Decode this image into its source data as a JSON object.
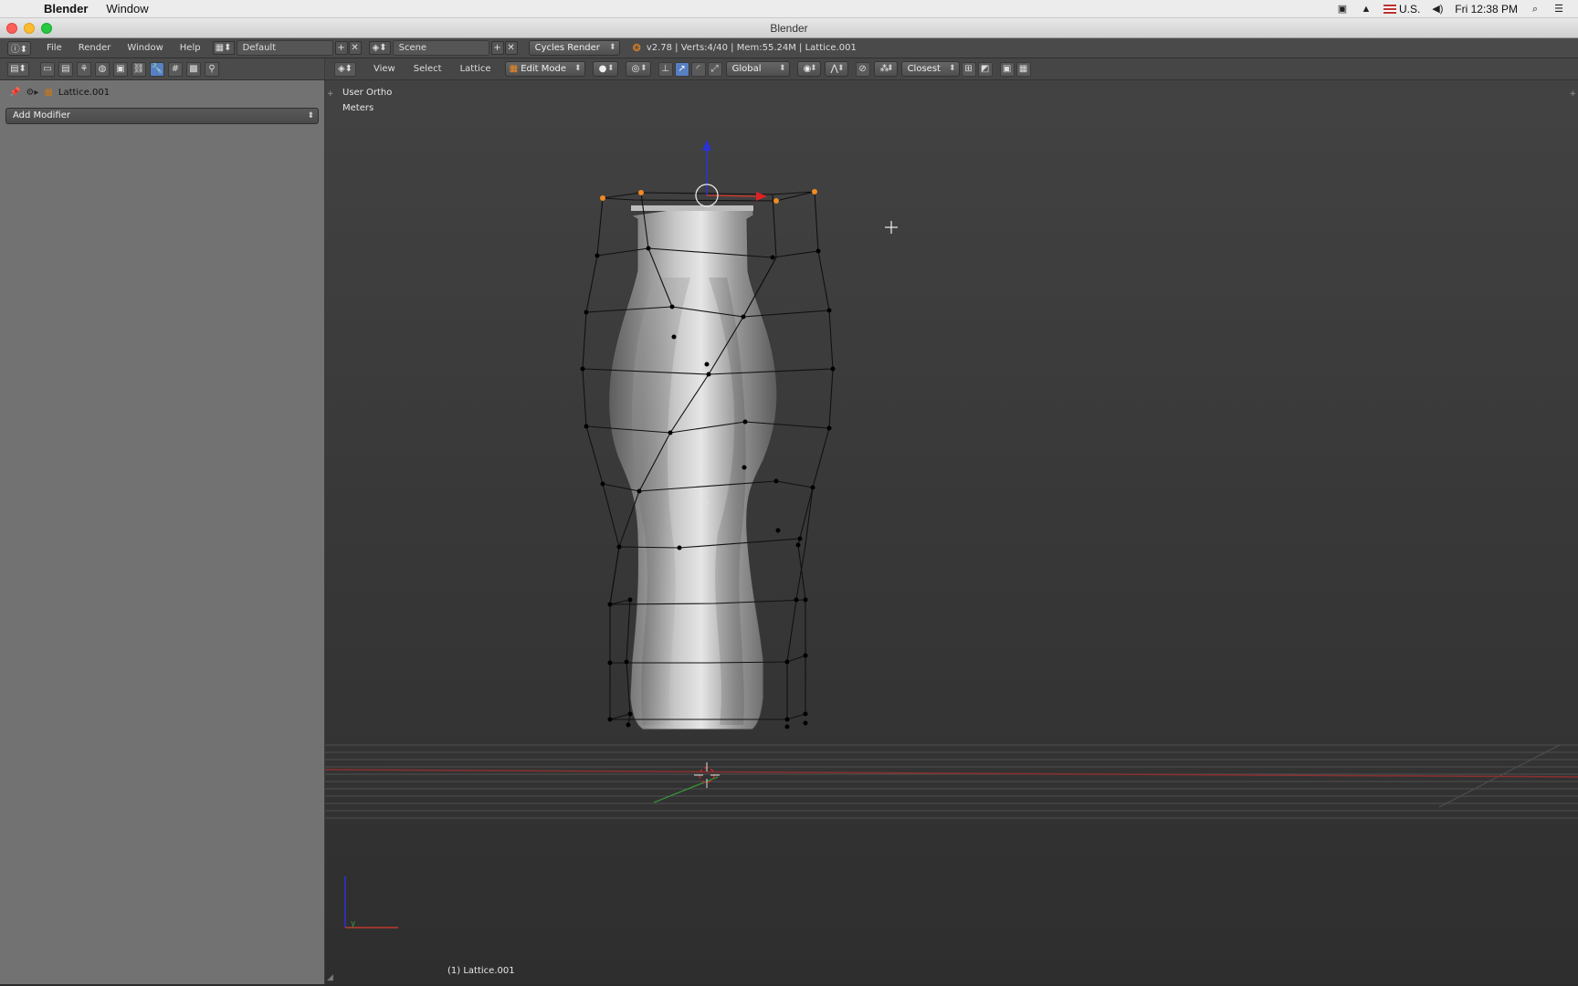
{
  "macos_menubar": {
    "app_name": "Blender",
    "menu_window": "Window",
    "keyboard_layout": "U.S.",
    "clock": "Fri 12:38 PM"
  },
  "window": {
    "title": "Blender"
  },
  "info_header": {
    "menus": [
      "File",
      "Render",
      "Window",
      "Help"
    ],
    "screen_layout": "Default",
    "scene": "Scene",
    "render_engine": "Cycles Render",
    "stats": "v2.78 | Verts:4/40 | Mem:55.24M | Lattice.001"
  },
  "properties_panel": {
    "object_name": "Lattice.001",
    "add_modifier_label": "Add Modifier"
  },
  "viewport_header": {
    "view_label": "View",
    "select_label": "Select",
    "lattice_label": "Lattice",
    "mode": "Edit Mode",
    "orientation": "Global",
    "snap_target": "Closest"
  },
  "viewport": {
    "view_name": "User Ortho",
    "units": "Meters",
    "object_info": "(1) Lattice.001",
    "axis_y_label": "y"
  },
  "colors": {
    "selected_vertex": "#f08a24",
    "unselected_vertex": "#000000",
    "x_axis": "#c0392b",
    "y_axis": "#3a9a3a",
    "z_axis": "#2a33d8",
    "active_tool": "#5680c2"
  }
}
